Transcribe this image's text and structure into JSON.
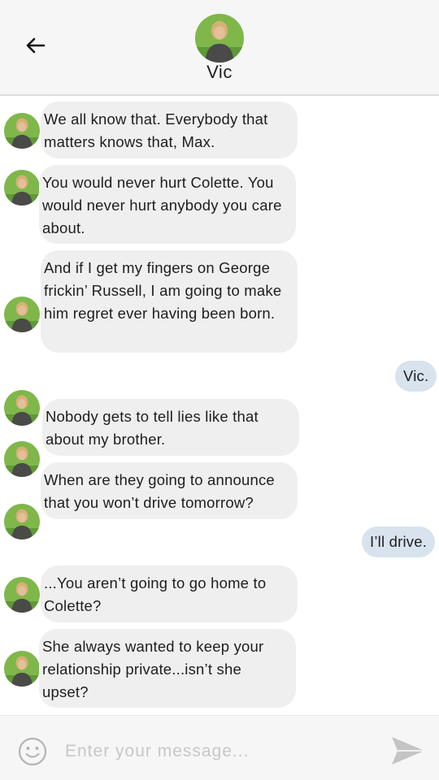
{
  "header": {
    "contact_name": "Vic",
    "back_icon": "arrow-left-icon"
  },
  "messages": [
    {
      "sender": "Vic",
      "direction": "incoming",
      "text": "We all know that. Everybody that matters knows that, Max."
    },
    {
      "sender": "Vic",
      "direction": "incoming",
      "text": "You would never hurt Colette. You would never hurt anybody you care about."
    },
    {
      "sender": "Vic",
      "direction": "incoming",
      "text": "And if I get my fingers on George frickin’ Russell, I am going to make him regret ever having been born."
    },
    {
      "sender": "me",
      "direction": "outgoing",
      "text": "Vic."
    },
    {
      "sender": "Vic",
      "direction": "incoming",
      "text": "Nobody gets to tell lies like that about my brother."
    },
    {
      "sender": "Vic",
      "direction": "incoming",
      "text": "When are they going to announce that you won’t drive tomorrow?"
    },
    {
      "sender": "me",
      "direction": "outgoing",
      "text": "I’ll drive."
    },
    {
      "sender": "Vic",
      "direction": "incoming",
      "text": "...You aren’t going to go home to Colette?"
    },
    {
      "sender": "Vic",
      "direction": "incoming",
      "text": "She always wanted to keep your relationship private...isn’t she upset?"
    }
  ],
  "composer": {
    "placeholder": "Enter your message...",
    "emoji_icon": "smiley-icon",
    "send_icon": "send-arrow-icon"
  },
  "colors": {
    "incoming_bubble": "#efefef",
    "outgoing_bubble": "#d8e3ee",
    "header_bg": "#f6f6f6"
  }
}
